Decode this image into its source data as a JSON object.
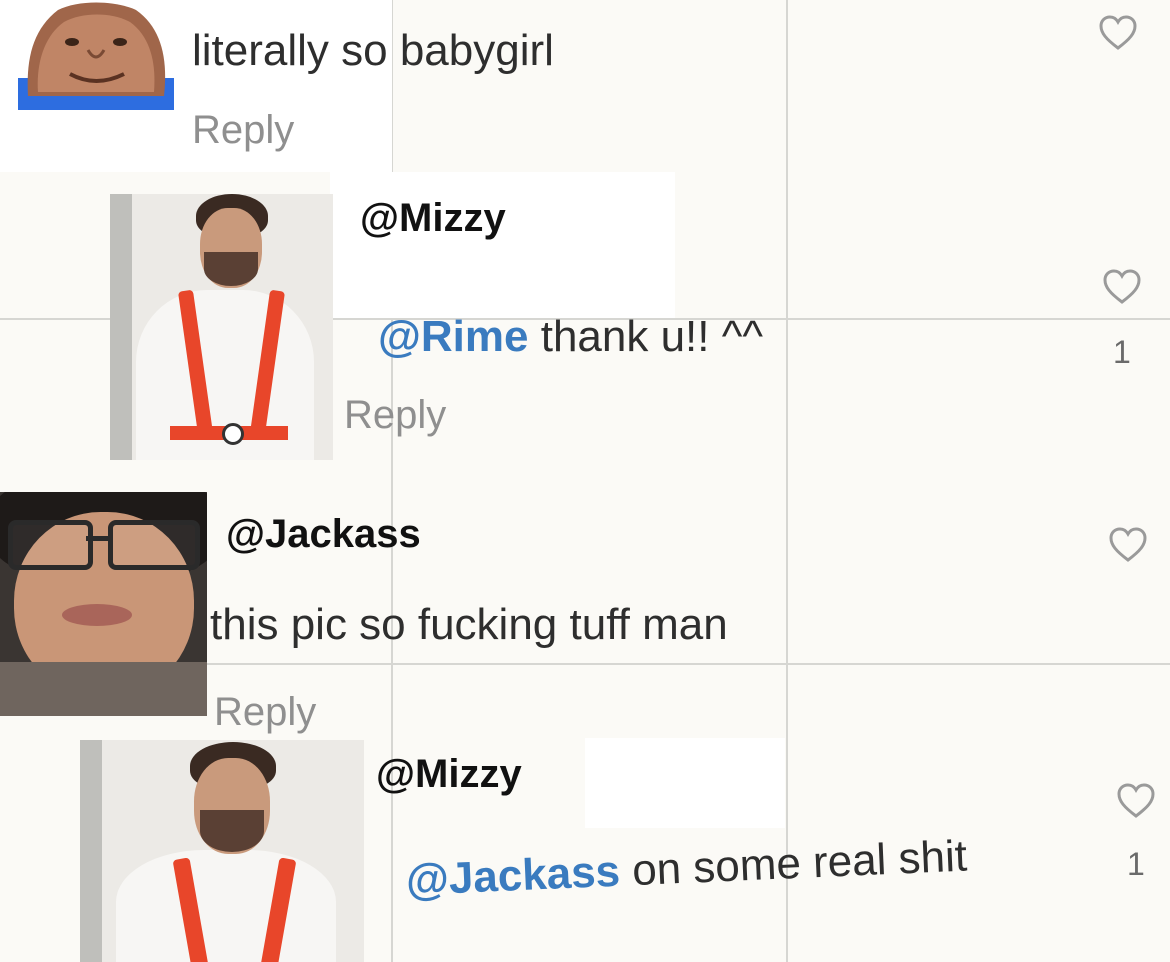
{
  "comments": [
    {
      "text": "literally so babygirl",
      "reply": "Reply"
    },
    {
      "handle": "@Mizzy",
      "mention": "@Rime",
      "text": " thank u!! ^^",
      "reply": "Reply",
      "likes": "1"
    },
    {
      "handle": "@Jackass",
      "text": "this pic so fucking tuff man",
      "reply": "Reply"
    },
    {
      "handle": "@Mizzy",
      "mention": "@Jackass",
      "text": " on some real shit",
      "likes": "1"
    }
  ],
  "icons": {
    "like": "heart-outline-icon"
  },
  "colors": {
    "mention": "#3a7bbf",
    "background": "#fbfaf6",
    "suspender": "#e8462a"
  }
}
